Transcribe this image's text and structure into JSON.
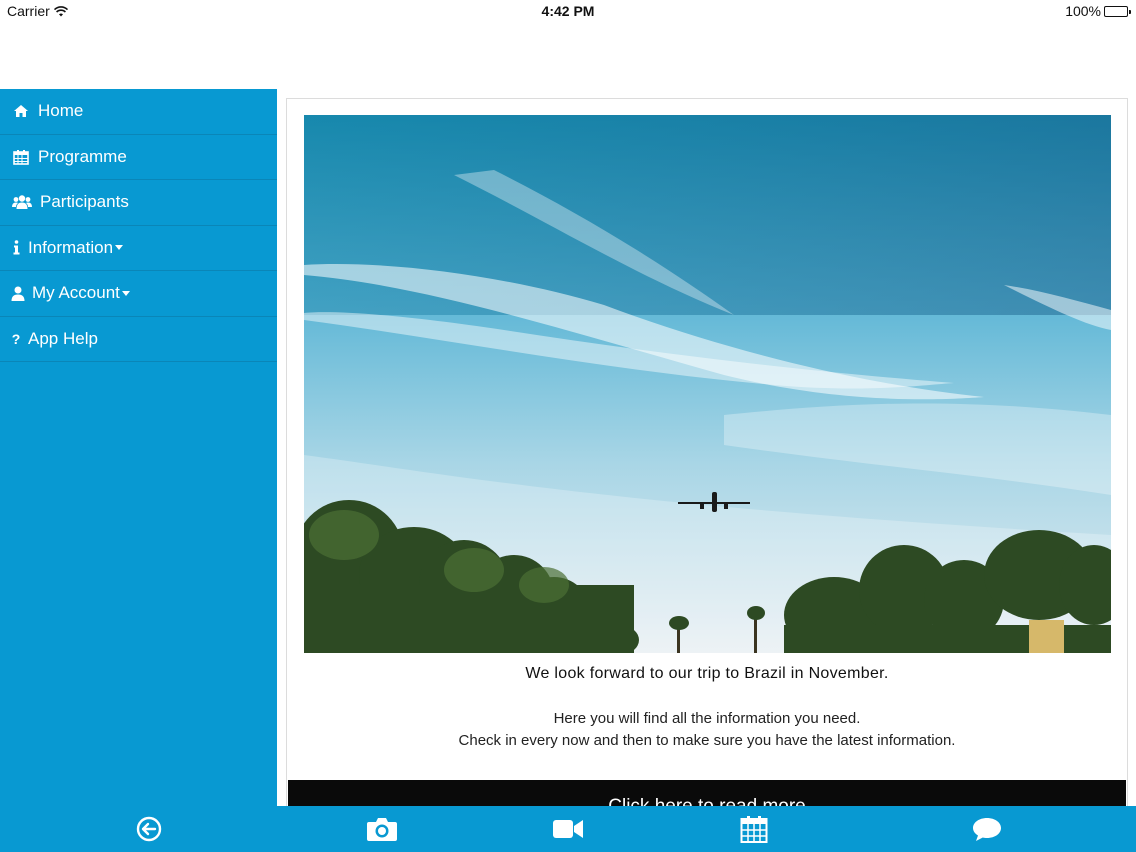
{
  "status_bar": {
    "carrier": "Carrier",
    "time": "4:42 PM",
    "battery": "100%"
  },
  "sidebar": {
    "items": [
      {
        "label": "Home",
        "icon": "home-icon"
      },
      {
        "label": "Programme",
        "icon": "calendar-icon"
      },
      {
        "label": "Participants",
        "icon": "users-icon"
      },
      {
        "label": "Information",
        "icon": "info-icon",
        "dropdown": true
      },
      {
        "label": "My Account",
        "icon": "user-icon",
        "dropdown": true
      },
      {
        "label": "App Help",
        "icon": "question-icon"
      }
    ]
  },
  "main": {
    "hero_image": "airplane-over-palm-trees-photo",
    "headline": "We look forward to our trip to Brazil in November.",
    "body_lines": [
      "Here you will find all the information you need.",
      "Check in every now and then to make sure you have the latest information."
    ],
    "cta_label": "Click here to read more"
  },
  "tabbar": {
    "items": [
      "back-arrow-icon",
      "camera-icon",
      "video-icon",
      "calendar-icon",
      "chat-bubble-icon"
    ]
  },
  "colors": {
    "primary": "#0899d2",
    "cta_background": "#0a0a0a"
  }
}
